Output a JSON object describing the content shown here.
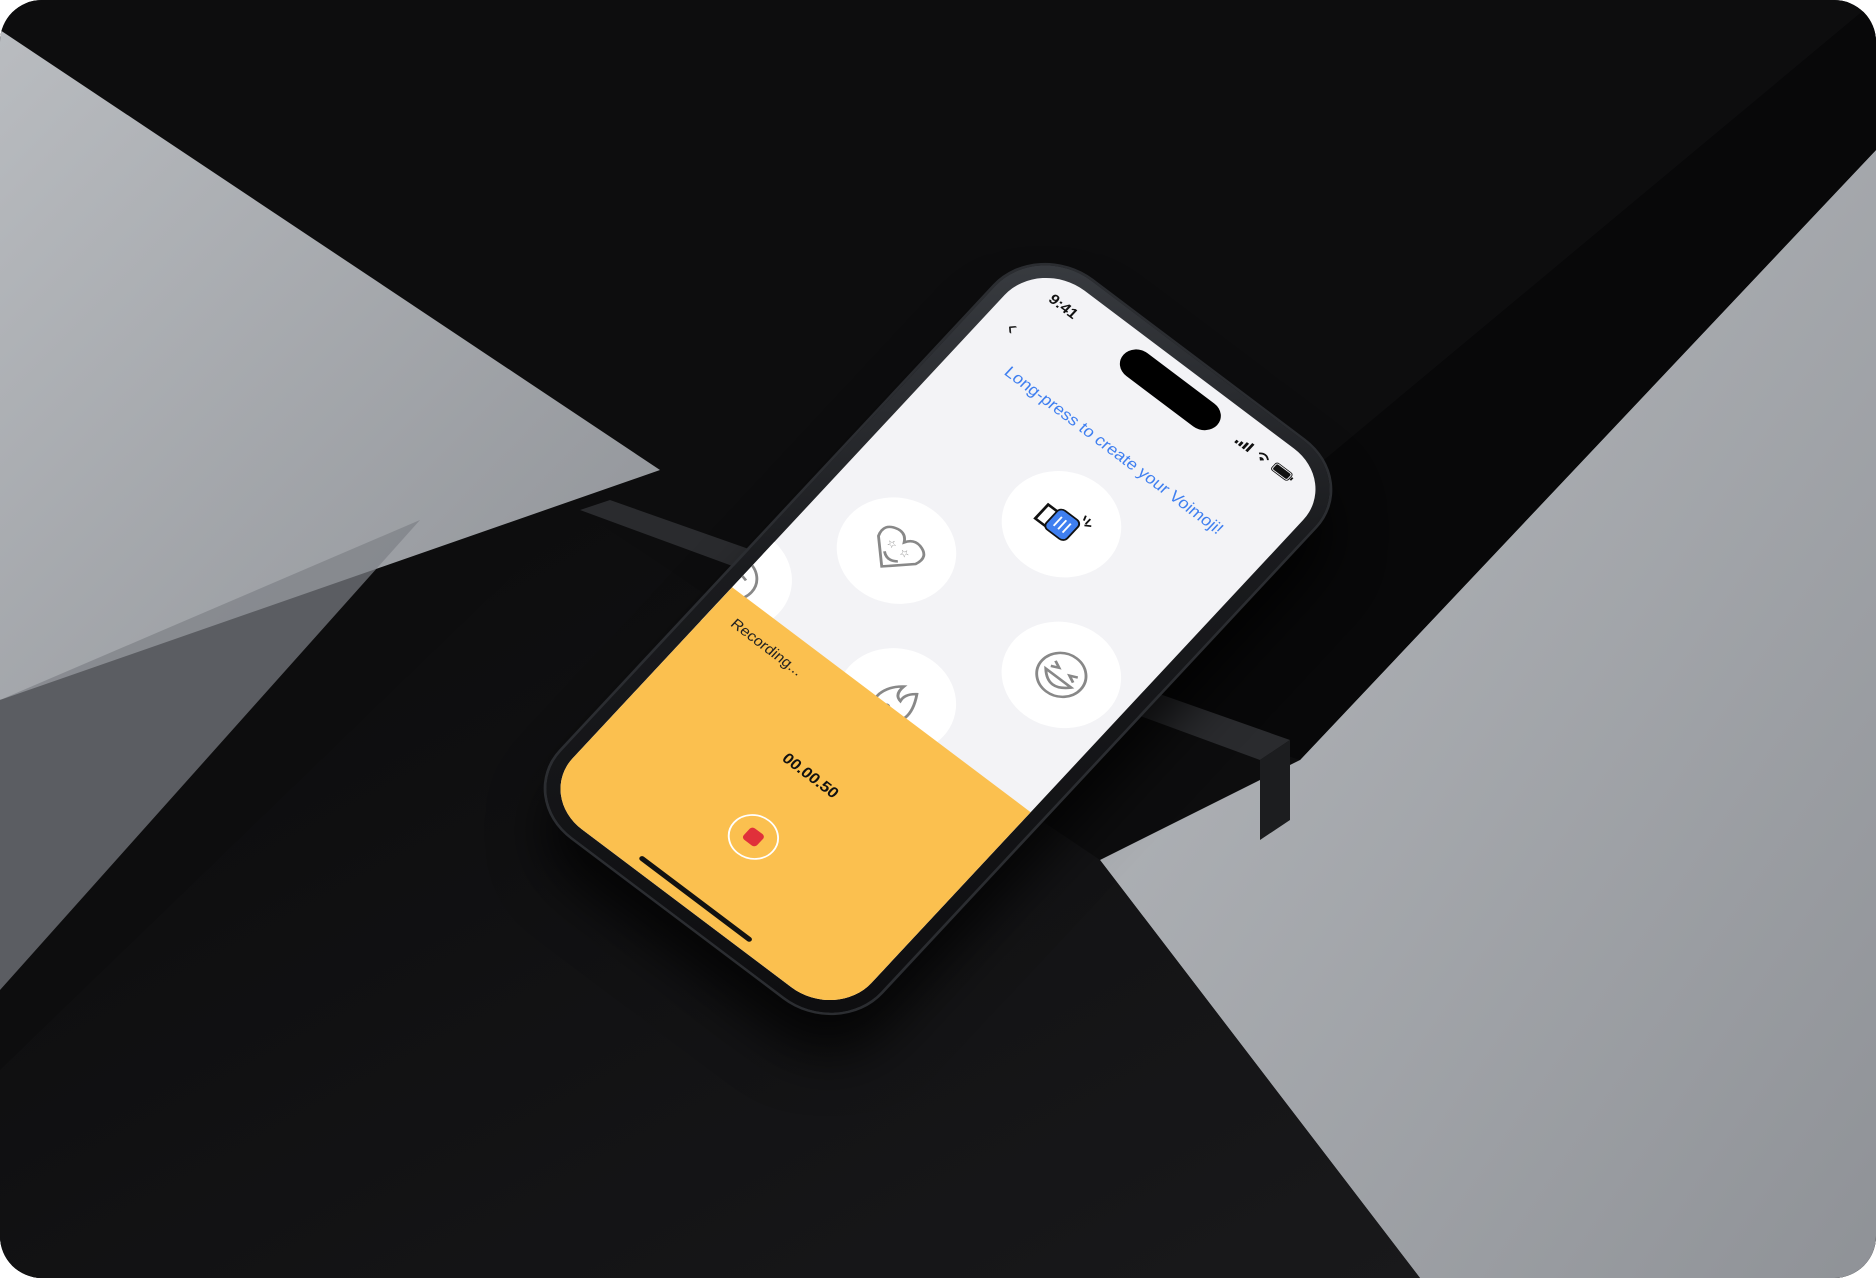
{
  "status_bar": {
    "time": "9:41"
  },
  "screen": {
    "back_icon": "chevron-left-icon",
    "prompt": "Long-press to create your Voimoji!",
    "emojis": [
      {
        "name": "fist-bump-emoji",
        "selected": true
      },
      {
        "name": "grinning-squint-emoji",
        "selected": false
      },
      {
        "name": "heart-star-eyes-emoji",
        "selected": false
      },
      {
        "name": "fire-emoji",
        "selected": false
      },
      {
        "name": "sad-sweat-emoji",
        "selected": false
      },
      {
        "name": "surprised-emoji",
        "selected": false
      }
    ]
  },
  "recorder": {
    "label": "Recording...",
    "time": "00.00.50",
    "stop_icon": "stop-icon"
  },
  "colors": {
    "accent_blue": "#3f7ff0",
    "recorder_yellow": "#fbc04f",
    "stop_red": "#e0303a",
    "screen_bg": "#f3f3f6"
  }
}
